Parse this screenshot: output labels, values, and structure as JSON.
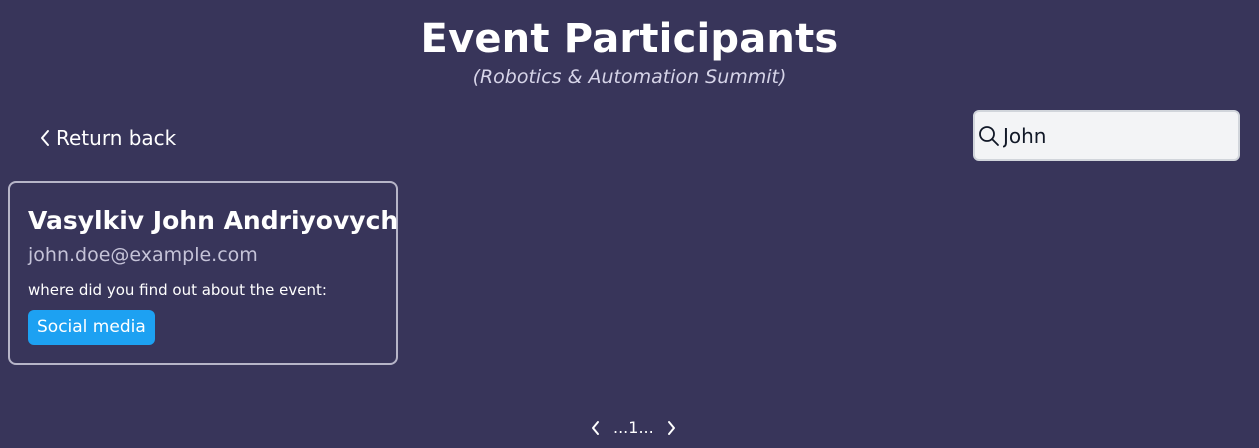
{
  "header": {
    "title": "Event Participants",
    "subtitle": "(Robotics & Automation Summit)"
  },
  "nav": {
    "back_label": "Return back",
    "back_icon": "chevron-left-icon"
  },
  "search": {
    "value": "John",
    "icon": "search-icon"
  },
  "participants": [
    {
      "name": "Vasylkiv John Andriyovych",
      "email": "john.doe@example.com",
      "question": "where did you find out about the event:",
      "answer": "Social media"
    }
  ],
  "pagination": {
    "text": "...1...",
    "prev_icon": "chevron-left-icon",
    "next_icon": "chevron-right-icon"
  },
  "colors": {
    "background": "#38355a",
    "tag": "#1da1f2",
    "search_bg": "#f3f4f6"
  }
}
